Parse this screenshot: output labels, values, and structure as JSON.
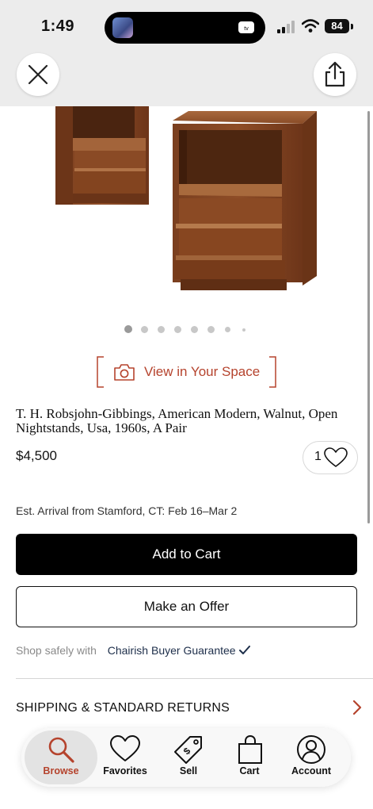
{
  "status_bar": {
    "time": "1:49",
    "battery": "84"
  },
  "header": {
    "close_icon": "close-icon",
    "share_icon": "share-icon"
  },
  "gallery": {
    "dot_count": 8,
    "active_index": 0
  },
  "view_in_space": {
    "label": "View in Your Space",
    "icon": "camera-icon"
  },
  "product": {
    "title": "T. H. Robsjohn-Gibbings, American Modern, Walnut, Open Nightstands, Usa, 1960s, A Pair",
    "price": "$4,500",
    "favorites_count": "1"
  },
  "delivery": {
    "arrival": "Est. Arrival from Stamford, CT: Feb 16–Mar 2"
  },
  "actions": {
    "add_to_cart": "Add to Cart",
    "make_offer": "Make an Offer"
  },
  "guarantee": {
    "prefix": "Shop safely with",
    "link": "Chairish Buyer Guarantee"
  },
  "shipping": {
    "label": "SHIPPING & STANDARD RETURNS"
  },
  "tabbar": {
    "tabs": [
      {
        "label": "Browse",
        "icon": "search-icon"
      },
      {
        "label": "Favorites",
        "icon": "heart-icon"
      },
      {
        "label": "Sell",
        "icon": "tag-icon"
      },
      {
        "label": "Cart",
        "icon": "shopping-bag-icon"
      },
      {
        "label": "Account",
        "icon": "user-icon"
      }
    ],
    "active": "Browse"
  },
  "colors": {
    "accent": "#b5432d",
    "link": "#1d2e4a",
    "button_primary": "#000000"
  }
}
